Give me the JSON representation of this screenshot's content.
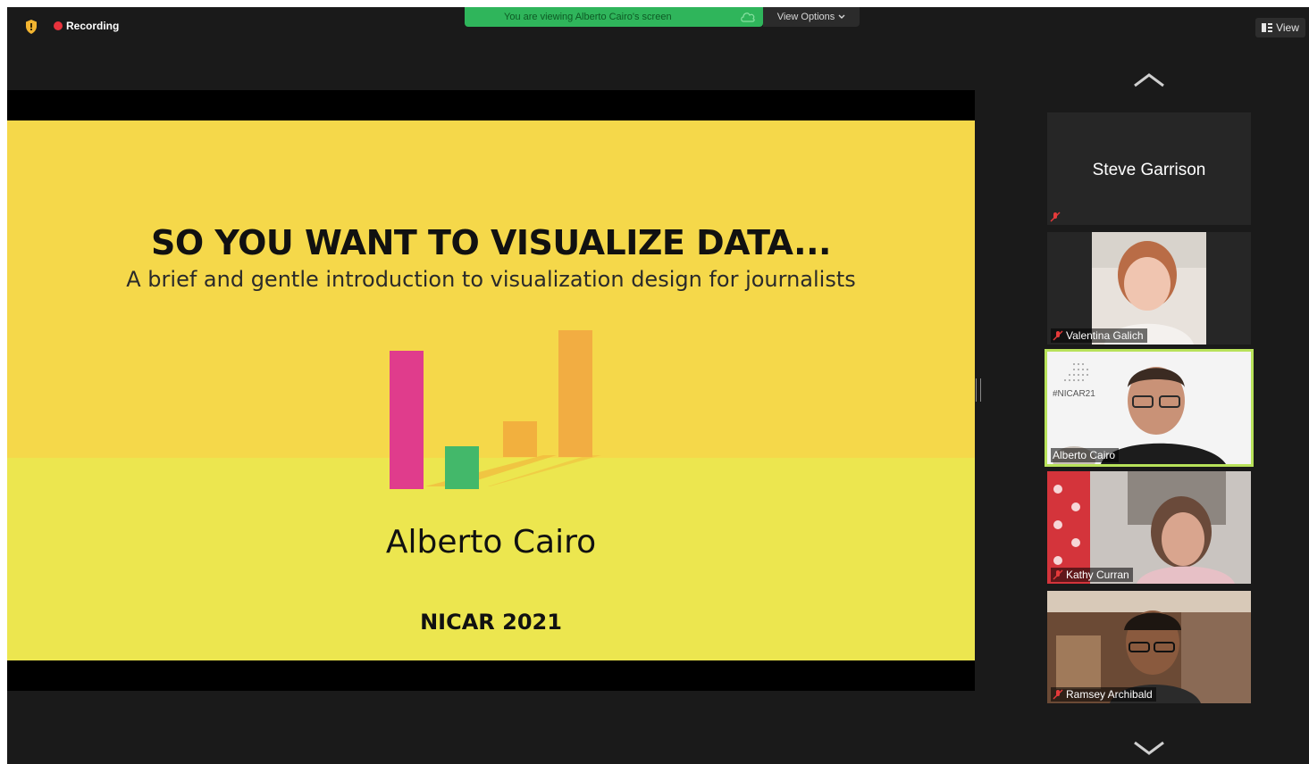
{
  "topbar": {
    "recording_label": "Recording",
    "viewing_banner": "You are viewing Alberto Cairo's screen",
    "view_options_label": "View Options",
    "view_label": "View"
  },
  "slide": {
    "title": "SO YOU WANT TO VISUALIZE DATA...",
    "subtitle": "A brief and gentle introduction to visualization design for journalists",
    "author": "Alberto Cairo",
    "event": "NICAR 2021"
  },
  "participants": [
    {
      "name": "Steve Garrison",
      "video": false,
      "muted": true
    },
    {
      "name": "Valentina Galich",
      "video": true,
      "muted": true
    },
    {
      "name": "Alberto Cairo",
      "video": true,
      "muted": false,
      "active_speaker": true,
      "background_text": "#NICAR21"
    },
    {
      "name": "Kathy Curran",
      "video": true,
      "muted": true
    },
    {
      "name": "Ramsey Archibald",
      "video": true,
      "muted": true
    }
  ],
  "colors": {
    "banner_green": "#2fb55b",
    "active_border": "#b8e25a",
    "slide_yellow": "#f5d84a",
    "recording_red": "#e8323c"
  }
}
